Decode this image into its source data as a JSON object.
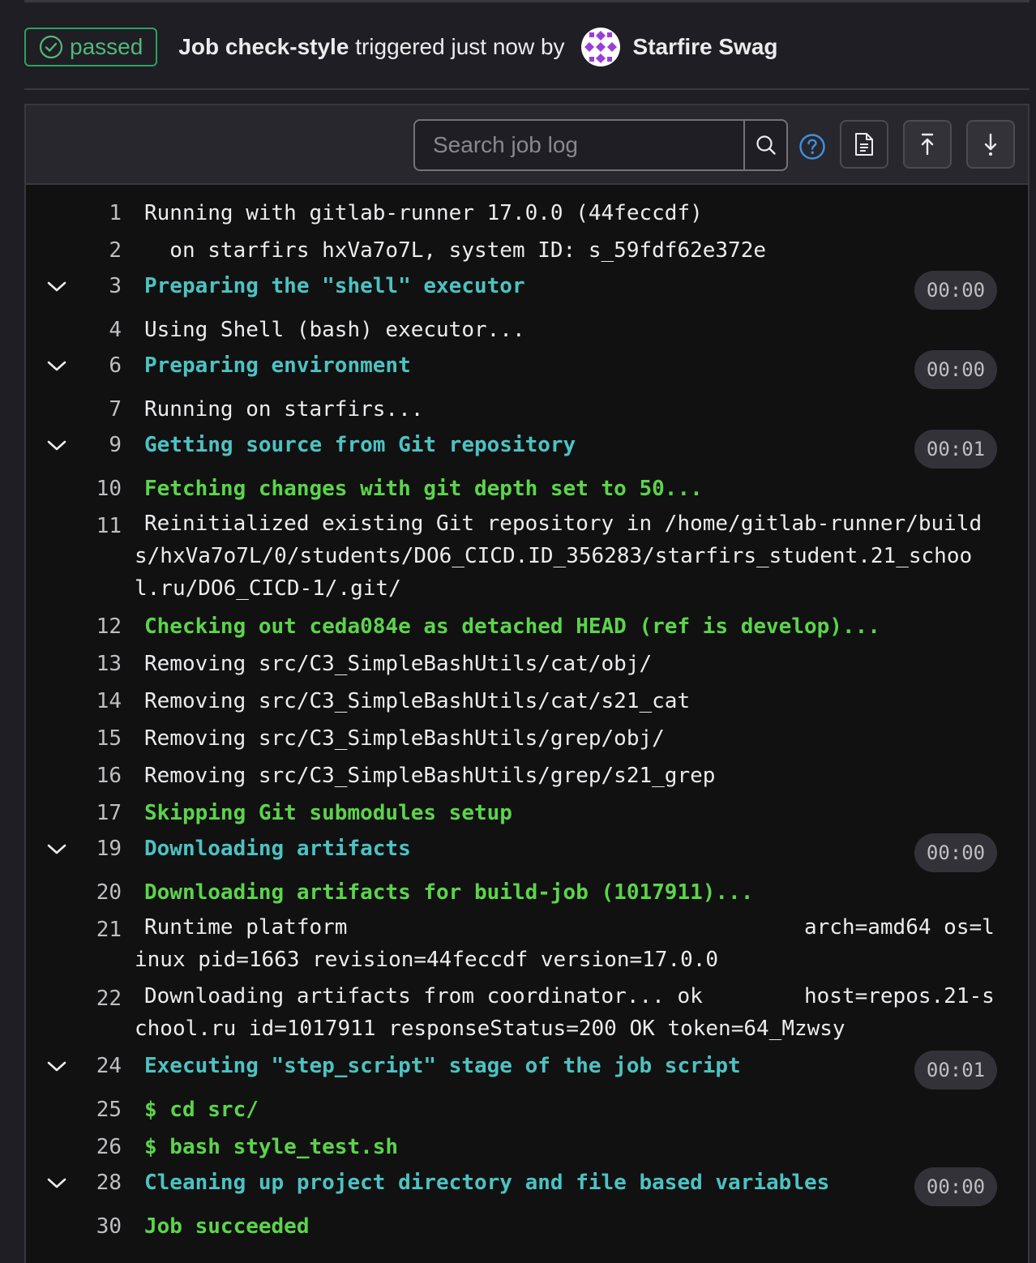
{
  "job": {
    "status": "passed",
    "title_prefix": "Job",
    "name": "check-style",
    "trigger_text": "triggered just now by",
    "user_name": "Starfire Swag",
    "status_color": "#2da160"
  },
  "toolbar": {
    "search_placeholder": "Search job log",
    "icons": [
      "search-icon",
      "help-icon",
      "raw-log-icon",
      "scroll-to-top-icon",
      "scroll-to-bottom-icon"
    ]
  },
  "log": [
    {
      "n": "1",
      "text": "Running with gitlab-runner 17.0.0 (44feccdf)",
      "style": "plain"
    },
    {
      "n": "2",
      "text": "  on starfirs hxVa7o7L, system ID: s_59fdf62e372e",
      "style": "plain"
    },
    {
      "n": "3",
      "text": "Preparing the \"shell\" executor",
      "style": "section",
      "duration": "00:00"
    },
    {
      "n": "4",
      "text": "Using Shell (bash) executor...",
      "style": "plain"
    },
    {
      "n": "6",
      "text": "Preparing environment",
      "style": "section",
      "duration": "00:00"
    },
    {
      "n": "7",
      "text": "Running on starfirs...",
      "style": "plain"
    },
    {
      "n": "9",
      "text": "Getting source from Git repository",
      "style": "section",
      "duration": "00:01"
    },
    {
      "n": "10",
      "text": "Fetching changes with git depth set to 50...",
      "style": "green"
    },
    {
      "n": "11",
      "text": "Reinitialized existing Git repository in /home/gitlab-runner/builds/hxVa7o7L/0/students/DO6_CICD.ID_356283/starfirs_student.21_school.ru/DO6_CICD-1/.git/",
      "style": "plain"
    },
    {
      "n": "12",
      "text": "Checking out ceda084e as detached HEAD (ref is develop)...",
      "style": "green"
    },
    {
      "n": "13",
      "text": "Removing src/C3_SimpleBashUtils/cat/obj/",
      "style": "plain"
    },
    {
      "n": "14",
      "text": "Removing src/C3_SimpleBashUtils/cat/s21_cat",
      "style": "plain"
    },
    {
      "n": "15",
      "text": "Removing src/C3_SimpleBashUtils/grep/obj/",
      "style": "plain"
    },
    {
      "n": "16",
      "text": "Removing src/C3_SimpleBashUtils/grep/s21_grep",
      "style": "plain"
    },
    {
      "n": "17",
      "text": "Skipping Git submodules setup",
      "style": "green"
    },
    {
      "n": "19",
      "text": "Downloading artifacts",
      "style": "section",
      "duration": "00:00"
    },
    {
      "n": "20",
      "text": "Downloading artifacts for build-job (1017911)...",
      "style": "green"
    },
    {
      "n": "21",
      "text": "Runtime platform                                    arch=amd64 os=linux pid=1663 revision=44feccdf version=17.0.0",
      "style": "plain"
    },
    {
      "n": "22",
      "text": "Downloading artifacts from coordinator... ok        host=repos.21-school.ru id=1017911 responseStatus=200 OK token=64_Mzwsy",
      "style": "plain"
    },
    {
      "n": "24",
      "text": "Executing \"step_script\" stage of the job script",
      "style": "section",
      "duration": "00:01"
    },
    {
      "n": "25",
      "text": "$ cd src/",
      "style": "green"
    },
    {
      "n": "26",
      "text": "$ bash style_test.sh",
      "style": "green"
    },
    {
      "n": "28",
      "text": "Cleaning up project directory and file based variables",
      "style": "section",
      "duration": "00:00"
    },
    {
      "n": "30",
      "text": "Job succeeded",
      "style": "green"
    }
  ]
}
